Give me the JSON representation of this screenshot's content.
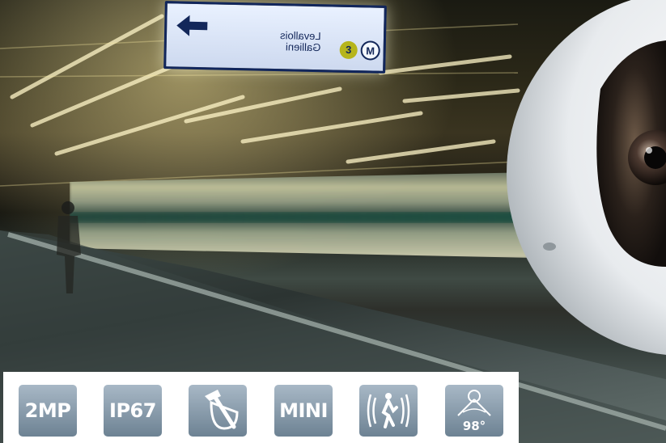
{
  "sign": {
    "line_1": "Levallois",
    "line_2": "Gallieni",
    "line_number": "3",
    "metro_symbol": "M",
    "arrow_icon": "arrow-left-icon"
  },
  "features": [
    {
      "label": "2MP",
      "icon": "resolution-text-icon"
    },
    {
      "label": "IP67",
      "icon": "ip-rating-text-icon"
    },
    {
      "label": "",
      "icon": "vandal-proof-hammer-icon"
    },
    {
      "label": "MINI",
      "icon": "mini-size-text-icon"
    },
    {
      "label": "",
      "icon": "motion-detection-person-icon"
    },
    {
      "label": "98°",
      "icon": "field-of-view-icon"
    }
  ],
  "colors": {
    "icon_tile_top": "#a8b8c6",
    "icon_tile_bottom": "#6d8293",
    "sign_border": "#11265c",
    "metro_line_3": "#b6b51c"
  }
}
